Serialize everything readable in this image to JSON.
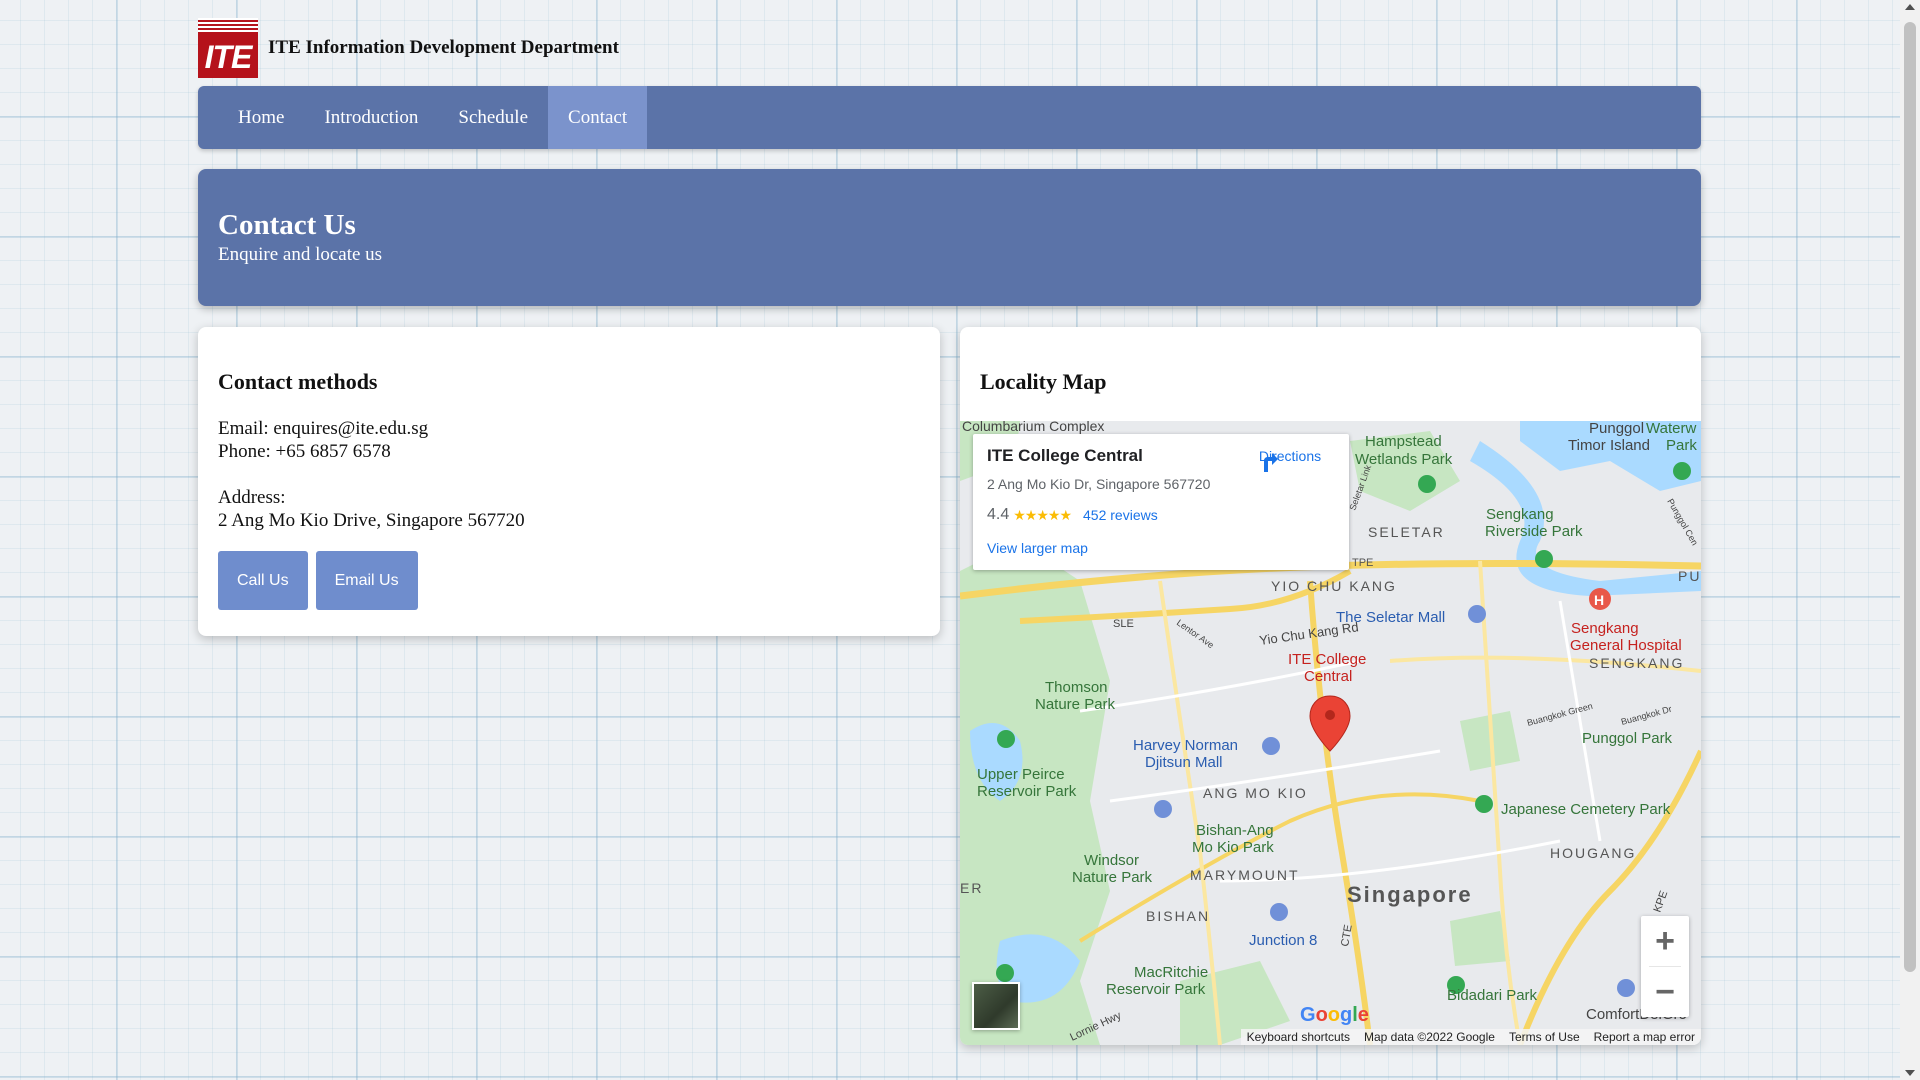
{
  "header": {
    "logo_text": "ITE",
    "title": "ITE Information Development Department"
  },
  "nav": {
    "items": [
      {
        "label": "Home"
      },
      {
        "label": "Introduction"
      },
      {
        "label": "Schedule"
      },
      {
        "label": "Contact",
        "active": true
      }
    ]
  },
  "hero": {
    "title": "Contact Us",
    "subtitle": "Enquire and locate us"
  },
  "contact": {
    "heading": "Contact methods",
    "email": "Email: enquires@ite.edu.sg",
    "phone": "Phone: +65 6857 6578",
    "address_label": "Address:",
    "address": "2 Ang Mo Kio Drive, Singapore 567720",
    "call_button": "Call Us",
    "email_button": "Email Us"
  },
  "map": {
    "heading": "Locality Map",
    "place": {
      "name": "ITE College Central",
      "address": "2 Ang Mo Kio Dr, Singapore 567720",
      "rating": "4.4",
      "stars": "★★★★★",
      "reviews": "452 reviews",
      "view_larger": "View larger map",
      "directions": "Directions"
    },
    "labels": {
      "columbarium": "Columbarium Complex",
      "hampstead_1": "Hampstead",
      "hampstead_2": "Wetlands Park",
      "punggol_1": "Punggol",
      "punggol_2": "Timor Island",
      "waterway": "Waterw",
      "park": "Park",
      "sengkang_rp_1": "Sengkang",
      "sengkang_rp_2": "Riverside Park",
      "seletar": "SELETAR",
      "tpe": "TPE",
      "pun": "PUN",
      "yio_chu_kang": "YIO CHU KANG",
      "seletar_mall": "The Seletar Mall",
      "sgh_1": "Sengkang",
      "sgh_2": "General Hospital",
      "sengkang": "SENGKANG",
      "sle": "SLE",
      "ycy_rd": "Yio Chu Kang Rd",
      "ite_1": "ITE College",
      "ite_2": "Central",
      "thomson_1": "Thomson",
      "thomson_2": "Nature Park",
      "harvey_1": "Harvey Norman",
      "harvey_2": "Djitsun Mall",
      "punggol_park": "Punggol Park",
      "upper_peirce_1": "Upper Peirce",
      "upper_peirce_2": "Reservoir Park",
      "ang_mo_kio": "ANG MO KIO",
      "japanese_cemetery": "Japanese Cemetery Park",
      "bishan_amk_1": "Bishan-Ang",
      "bishan_amk_2": "Mo Kio Park",
      "hougang": "HOUGANG",
      "windsor_1": "Windsor",
      "windsor_2": "Nature Park",
      "marymount": "MARYMOUNT",
      "er": "ER",
      "bishan": "BISHAN",
      "singapore": "Singapore",
      "cte": "CTE",
      "kpe": "KPE",
      "junction8": "Junction 8",
      "macritchie_1": "MacRitchie",
      "macritchie_2": "Reservoir Park",
      "bidadari": "Bidadari Park",
      "comfortdelgro": "ComfortDelGro",
      "lornie": "Lornie Hwy",
      "buangkok": "Buangkok Dr",
      "buangkok_green": "Buangkok Green",
      "lentor": "Lentor Ave",
      "seletar_link": "Seletar Link",
      "punggol_central": "Punggol Cen"
    },
    "zoom_in": "+",
    "zoom_out": "−",
    "google": "Google",
    "attribution": {
      "keyboard": "Keyboard shortcuts",
      "data": "Map data ©2022 Google",
      "terms": "Terms of Use",
      "report": "Report a map error"
    }
  },
  "colors": {
    "brand_red": "#b5121b",
    "nav": "#5b73a8",
    "nav_active": "#7b93cc",
    "button": "#6f8dcd",
    "link": "#1a73e8"
  }
}
